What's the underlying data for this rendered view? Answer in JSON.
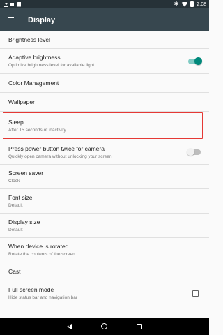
{
  "status_bar": {
    "time": "2:08",
    "left_icons": [
      "download-icon",
      "notification-icon",
      "sd-card-icon"
    ],
    "right_icons": [
      "bluetooth-icon",
      "wifi-icon",
      "battery-icon"
    ]
  },
  "app_bar": {
    "title": "Display",
    "menu_icon": "hamburger-menu-icon"
  },
  "settings": {
    "brightness_level": {
      "title": "Brightness level"
    },
    "adaptive_brightness": {
      "title": "Adaptive brightness",
      "summary": "Optimize brightness level for available light",
      "enabled": true
    },
    "color_management": {
      "title": "Color Management"
    },
    "wallpaper": {
      "title": "Wallpaper"
    },
    "sleep": {
      "title": "Sleep",
      "summary": "After 15 seconds of inactivity",
      "highlighted": true
    },
    "power_button_camera": {
      "title": "Press power button twice for camera",
      "summary": "Quickly open camera without unlocking your screen",
      "enabled": false
    },
    "screen_saver": {
      "title": "Screen saver",
      "summary": "Clock"
    },
    "font_size": {
      "title": "Font size",
      "summary": "Default"
    },
    "display_size": {
      "title": "Display size",
      "summary": "Default"
    },
    "device_rotated": {
      "title": "When device is rotated",
      "summary": "Rotate the contents of the screen"
    },
    "cast": {
      "title": "Cast"
    },
    "full_screen_mode": {
      "title": "Full screen mode",
      "summary": "Hide status bar and navigation bar",
      "checked": false
    }
  },
  "colors": {
    "status_bar": "#263238",
    "app_bar": "#37474f",
    "accent": "#00897b",
    "highlight_border": "#e53935",
    "background": "#fafafa"
  },
  "nav_bar": {
    "icons": [
      "back-icon",
      "home-icon",
      "recents-icon"
    ]
  }
}
